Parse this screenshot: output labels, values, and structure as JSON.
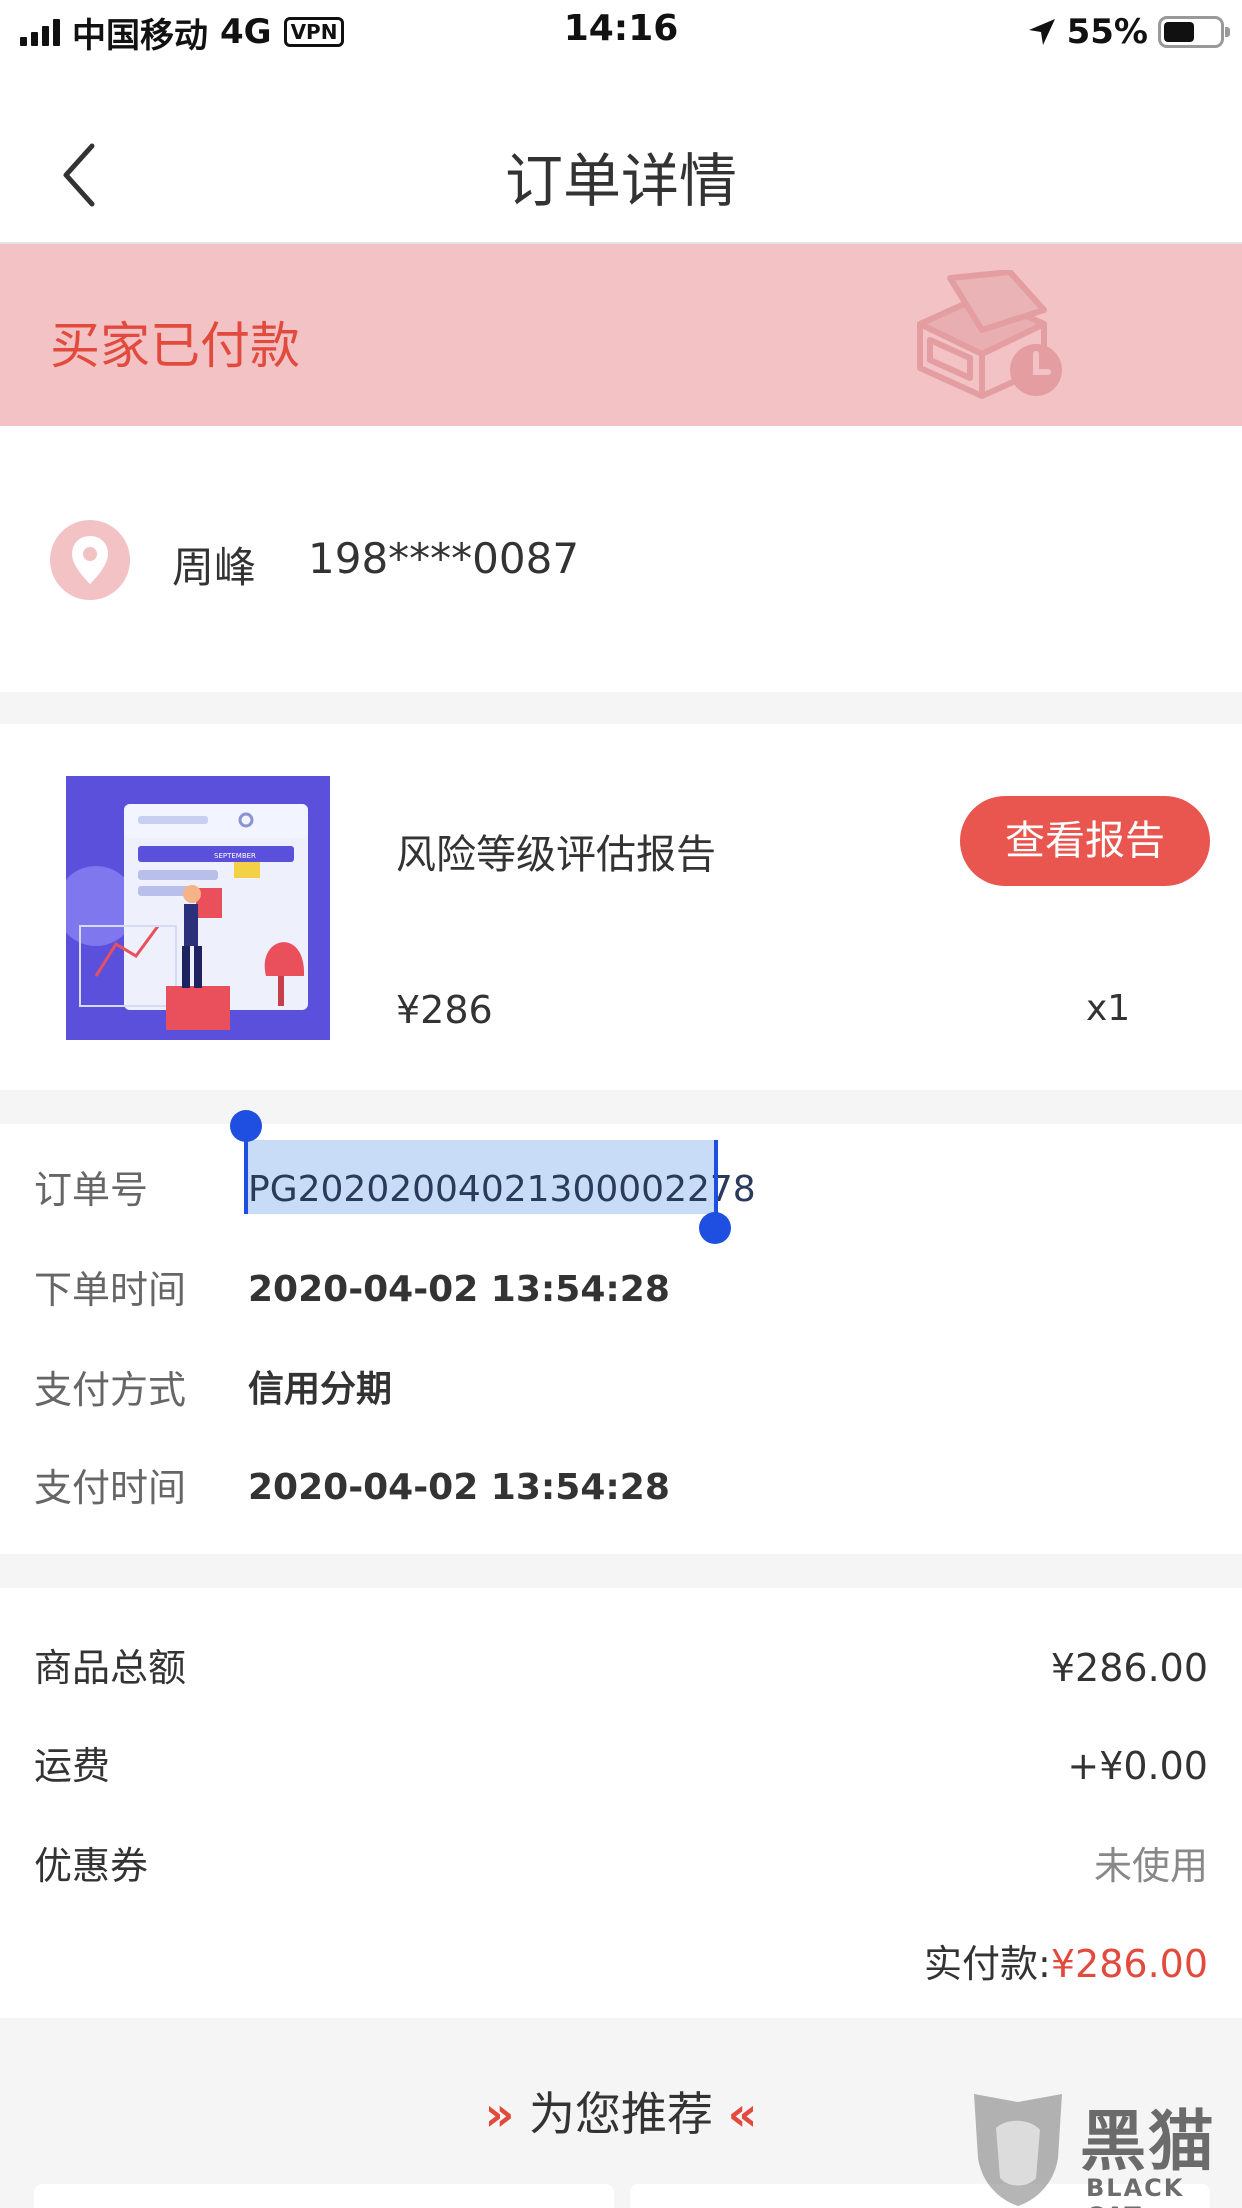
{
  "status_bar": {
    "carrier": "中国移动",
    "network": "4G",
    "vpn": "VPN",
    "time": "14:16",
    "battery": "55%"
  },
  "nav": {
    "title": "订单详情"
  },
  "banner": {
    "status": "买家已付款"
  },
  "address": {
    "name": "周峰",
    "phone": "198****0087"
  },
  "product": {
    "name": "风险等级评估报告",
    "button": "查看报告",
    "price": "¥286",
    "quantity": "x1",
    "thumbnail_text": "SEPTEMBER"
  },
  "order_info": [
    {
      "label": "订单号",
      "value": "PG20202004021300002278"
    },
    {
      "label": "下单时间",
      "value": "2020-04-02 13:54:28"
    },
    {
      "label": "支付方式",
      "value": "信用分期"
    },
    {
      "label": "支付时间",
      "value": "2020-04-02 13:54:28"
    }
  ],
  "totals": {
    "rows": [
      {
        "label": "商品总额",
        "value": "¥286.00"
      },
      {
        "label": "运费",
        "value": "+¥0.00"
      },
      {
        "label": "优惠券",
        "value": "未使用"
      }
    ],
    "paid_label": "实付款:",
    "paid_amount": "¥286.00"
  },
  "recommend": {
    "title": "为您推荐",
    "left_chevron": "»",
    "right_chevron": "«"
  },
  "watermark": {
    "cn": "黑猫",
    "en": "BLACK CAT"
  },
  "colors": {
    "accent": "#e34a3e",
    "banner_bg": "#f2c2c4",
    "button_bg": "#e95650",
    "selection": "#c8dbf7",
    "selection_handle": "#1f4fe0"
  }
}
